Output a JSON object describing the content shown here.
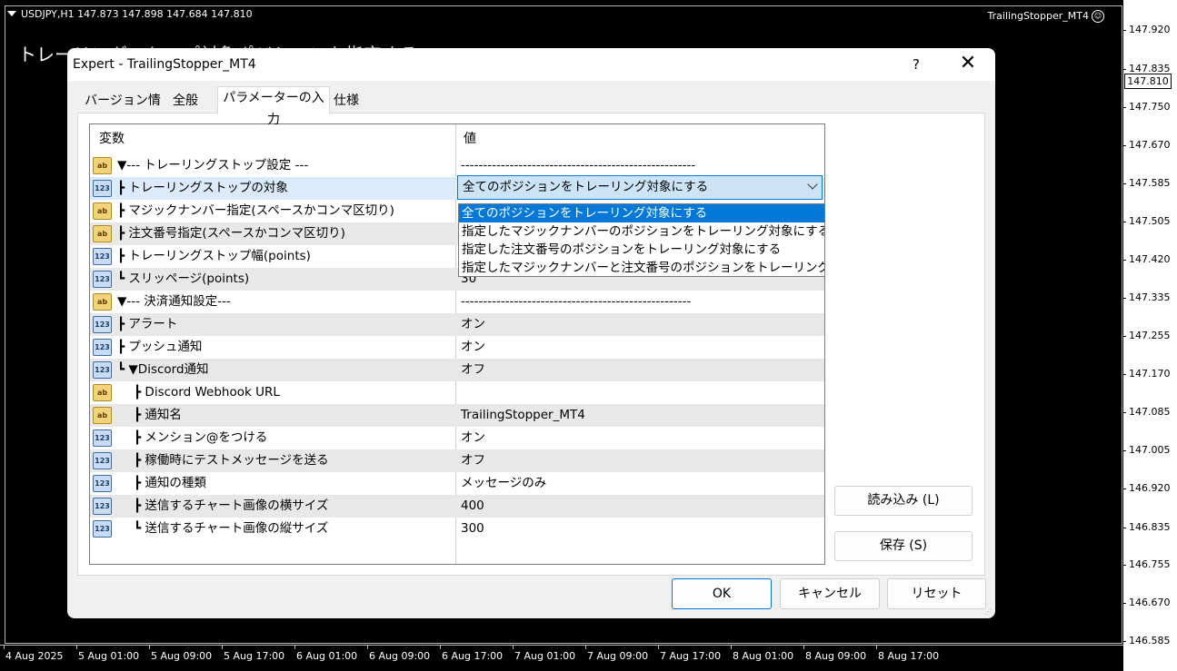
{
  "chart": {
    "symbol_info": "USDJPY,H1  147.873 147.898 147.684 147.810",
    "ea_name": "TrailingStopper_MT4",
    "overlay_text": "トレーリングストップ対象ポジションを指定する",
    "current_price": "147.810",
    "price_ticks": [
      "147.920",
      "147.835",
      "147.750",
      "147.670",
      "147.585",
      "147.505",
      "147.420",
      "147.335",
      "147.255",
      "147.170",
      "147.085",
      "147.005",
      "146.920",
      "146.835",
      "146.755",
      "146.670",
      "146.585"
    ],
    "time_ticks": [
      "4 Aug 2025",
      "5 Aug 01:00",
      "5 Aug 09:00",
      "5 Aug 17:00",
      "6 Aug 01:00",
      "6 Aug 09:00",
      "6 Aug 17:00",
      "7 Aug 01:00",
      "7 Aug 09:00",
      "7 Aug 17:00",
      "8 Aug 01:00",
      "8 Aug 09:00",
      "8 Aug 17:00"
    ]
  },
  "dialog": {
    "title": "Expert - TrailingStopper_MT4",
    "help": "?",
    "close": "✕",
    "tabs": [
      "バージョン情報",
      "全般",
      "パラメーターの入力",
      "仕様"
    ],
    "active_tab": "パラメーターの入力",
    "columns": {
      "variable": "変数",
      "value": "値"
    },
    "rows": [
      {
        "type": "ab",
        "name": "▼--- トレーリングストップ設定 ---",
        "value": "-----------------------------------------------------"
      },
      {
        "type": "123",
        "name": "┣ トレーリングストップの対象",
        "value": "全てのポジションをトレーリング対象にする"
      },
      {
        "type": "ab",
        "name": "┣ マジックナンバー指定(スペースかコンマ区切り)",
        "value": ""
      },
      {
        "type": "ab",
        "name": "┣ 注文番号指定(スペースかコンマ区切り)",
        "value": ""
      },
      {
        "type": "123",
        "name": "┣ トレーリングストップ幅(points)",
        "value": ""
      },
      {
        "type": "123",
        "name": "┗ スリッページ(points)",
        "value": "30"
      },
      {
        "type": "ab",
        "name": "▼--- 決済通知設定---",
        "value": "----------------------------------------------------"
      },
      {
        "type": "123",
        "name": "┣ アラート",
        "value": "オン"
      },
      {
        "type": "123",
        "name": "┣ プッシュ通知",
        "value": "オン"
      },
      {
        "type": "123",
        "name": "┗ ▼Discord通知",
        "value": "オフ"
      },
      {
        "type": "ab",
        "name": "┣ Discord Webhook URL",
        "value": ""
      },
      {
        "type": "ab",
        "name": "┣ 通知名",
        "value": "TrailingStopper_MT4"
      },
      {
        "type": "123",
        "name": "┣ メンション@をつける",
        "value": "オン"
      },
      {
        "type": "123",
        "name": "┣ 稼働時にテストメッセージを送る",
        "value": "オフ"
      },
      {
        "type": "123",
        "name": "┣ 通知の種類",
        "value": "メッセージのみ"
      },
      {
        "type": "123",
        "name": "┣ 送信するチャート画像の横サイズ",
        "value": "400"
      },
      {
        "type": "123",
        "name": "┗ 送信するチャート画像の縦サイズ",
        "value": "300"
      }
    ],
    "icon_labels": {
      "ab": "ab",
      "123": "123"
    },
    "dropdown_options": [
      "全てのポジションをトレーリング対象にする",
      "指定したマジックナンバーのポジションをトレーリング対象にする",
      "指定した注文番号のポジションをトレーリング対象にする",
      "指定したマジックナンバーと注文番号のポジションをトレーリング対象にする"
    ],
    "selected_option": "全てのポジションをトレーリング対象にする",
    "buttons": {
      "load": "読み込み (L)",
      "save": "保存 (S)",
      "ok": "OK",
      "cancel": "キャンセル",
      "reset": "リセット"
    }
  }
}
